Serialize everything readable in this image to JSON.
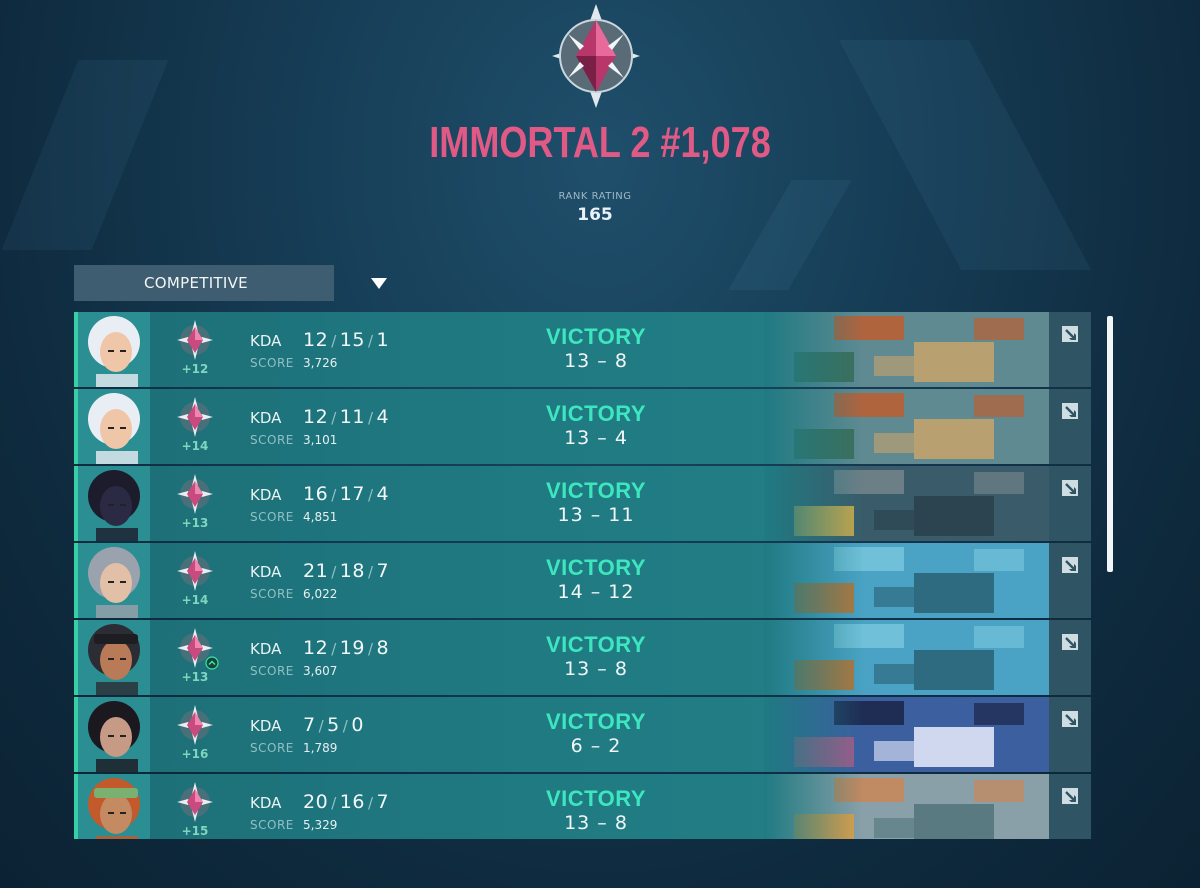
{
  "rank": {
    "title": "IMMORTAL 2 #1,078",
    "rating_label": "RANK RATING",
    "rating_value": "165",
    "icon": "immortal-rank-icon",
    "color": "#e05a85"
  },
  "mode_select": {
    "label": "COMPETITIVE",
    "icon": "caret-down-icon"
  },
  "matches": [
    {
      "agent": "jett",
      "rr_change": "+12",
      "kda_label": "KDA",
      "kills": "12",
      "deaths": "15",
      "assists": "1",
      "score_label": "SCORE",
      "score": "3,726",
      "result": "VICTORY",
      "rounds_won": "13",
      "round_sep": "–",
      "rounds_lost": "8",
      "map": "split"
    },
    {
      "agent": "jett",
      "rr_change": "+14",
      "kda_label": "KDA",
      "kills": "12",
      "deaths": "11",
      "assists": "4",
      "score_label": "SCORE",
      "score": "3,101",
      "result": "VICTORY",
      "rounds_won": "13",
      "round_sep": "–",
      "rounds_lost": "4",
      "map": "split"
    },
    {
      "agent": "omen",
      "rr_change": "+13",
      "kda_label": "KDA",
      "kills": "16",
      "deaths": "17",
      "assists": "4",
      "score_label": "SCORE",
      "score": "4,851",
      "result": "VICTORY",
      "rounds_won": "13",
      "round_sep": "–",
      "rounds_lost": "11",
      "map": "icebox"
    },
    {
      "agent": "viper",
      "rr_change": "+14",
      "kda_label": "KDA",
      "kills": "21",
      "deaths": "18",
      "assists": "7",
      "score_label": "SCORE",
      "score": "6,022",
      "result": "VICTORY",
      "rounds_won": "14",
      "round_sep": "–",
      "rounds_lost": "12",
      "map": "pearl"
    },
    {
      "agent": "raze",
      "rr_change": "+13",
      "kda_label": "KDA",
      "kills": "12",
      "deaths": "19",
      "assists": "8",
      "score_label": "SCORE",
      "score": "3,607",
      "result": "VICTORY",
      "rounds_won": "13",
      "round_sep": "–",
      "rounds_lost": "8",
      "map": "pearl",
      "rank_up": true
    },
    {
      "agent": "reyna",
      "rr_change": "+16",
      "kda_label": "KDA",
      "kills": "7",
      "deaths": "5",
      "assists": "0",
      "score_label": "SCORE",
      "score": "1,789",
      "result": "VICTORY",
      "rounds_won": "6",
      "round_sep": "–",
      "rounds_lost": "2",
      "map": "ascent"
    },
    {
      "agent": "killjoy",
      "rr_change": "+15",
      "kda_label": "KDA",
      "kills": "20",
      "deaths": "16",
      "assists": "7",
      "score_label": "SCORE",
      "score": "5,329",
      "result": "VICTORY",
      "rounds_won": "13",
      "round_sep": "–",
      "rounds_lost": "8",
      "map": "fracture"
    }
  ],
  "colors": {
    "victory": "#3ee6c0",
    "row": "#1f7a82",
    "accent": "#36d0a6"
  }
}
